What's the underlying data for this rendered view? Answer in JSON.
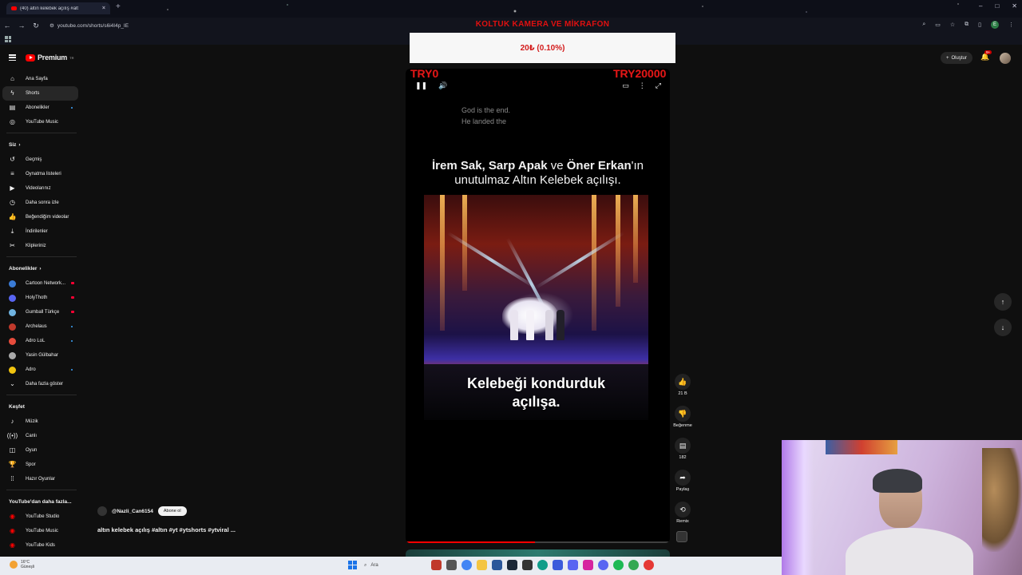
{
  "browser": {
    "tab_title": "(40) altın kelebek açılış #alt",
    "url": "youtube.com/shorts/s6i4I4p_IE"
  },
  "header": {
    "logo_text": "Premium",
    "logo_sup": "TR",
    "create_label": "Oluştur",
    "notif_badge": "9+"
  },
  "sidebar": {
    "main": [
      {
        "label": "Ana Sayfa",
        "icon": "home-icon"
      },
      {
        "label": "Shorts",
        "icon": "shorts-icon"
      },
      {
        "label": "Abonelikler",
        "icon": "subscriptions-icon"
      },
      {
        "label": "YouTube Music",
        "icon": "music-icon"
      }
    ],
    "you_title": "Siz",
    "you": [
      {
        "label": "Geçmiş"
      },
      {
        "label": "Oynatma listeleri"
      },
      {
        "label": "Videolarınız"
      },
      {
        "label": "Daha sonra izle"
      },
      {
        "label": "Beğendiğim videolar"
      },
      {
        "label": "İndirilenler"
      },
      {
        "label": "Klipleriniz"
      }
    ],
    "subs_title": "Abonelikler",
    "subs": [
      {
        "label": "Cartoon Network...",
        "color": "#3a7bd5"
      },
      {
        "label": "HolyThoth",
        "color": "#5865f2"
      },
      {
        "label": "Gumball Türkçe",
        "color": "#6fb3e0"
      },
      {
        "label": "Archelaus",
        "color": "#c0392b"
      },
      {
        "label": "Adro LoL",
        "color": "#e74c3c"
      },
      {
        "label": "Yasin Gülbahar",
        "color": "#aaaaaa"
      },
      {
        "label": "Adro",
        "color": "#f1c40f"
      }
    ],
    "more_label": "Daha fazla göster",
    "explore_title": "Keşfet",
    "explore": [
      {
        "label": "Müzik"
      },
      {
        "label": "Canlı"
      },
      {
        "label": "Oyun"
      },
      {
        "label": "Spor"
      },
      {
        "label": "Hazır Oyunlar"
      }
    ],
    "more_yt_title": "YouTube'dan daha fazla...",
    "more_yt": [
      {
        "label": "YouTube Studio"
      },
      {
        "label": "YouTube Music"
      },
      {
        "label": "YouTube Kids"
      }
    ]
  },
  "overlay": {
    "donation_title": "KOLTUK KAMERA VE MİKRAFON",
    "donation_progress": "20₺ (0.10%)",
    "progress_fraction": 0.001,
    "try_min": "TRY0",
    "try_max": "TRY20000"
  },
  "video": {
    "caption_line1": "God is the end.",
    "caption_line2": "He landed the",
    "title_name1": "İrem Sak,",
    "title_name2": "Sarp Apak",
    "title_and": "ve",
    "title_name3": "Öner Erkan",
    "title_suffix": "'ın",
    "title_line2": "unutulmaz Altın Kelebek açılışı.",
    "subtitle_line1": "Kelebeği kondurduk",
    "subtitle_line2": "açılışa.",
    "playback_fraction": 0.49
  },
  "actions": {
    "likes": "21 B",
    "dislike_label": "Beğenme",
    "comments": "182",
    "share_label": "Paylaş",
    "remix_label": "Remix"
  },
  "channel": {
    "handle": "@Nazli_Can6154",
    "subscribe_label": "Abone ol",
    "description": "altın kelebek açılış #altın #yt #ytshorts #ytviral ..."
  },
  "taskbar": {
    "temp": "16°C",
    "weather": "Güneşli",
    "search_label": "Ara"
  }
}
